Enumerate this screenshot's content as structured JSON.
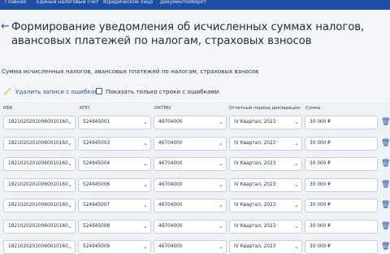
{
  "topnav": {
    "items": [
      "Главная",
      "Единый налоговый счет",
      "Юридическое лицо",
      "Документооборот"
    ]
  },
  "page": {
    "back_icon": "arrow-left-icon",
    "title": "Формирование уведомления об исчисленных суммах налогов, авансовых платежей по налогам, страховых взносов",
    "subtitle": "Сумма исчисленных налогов, авансовых платежей по налогам, страховых взносов"
  },
  "toolbar": {
    "delete_errors_label": "Удалить записи с ошибками",
    "show_errors_only_label": "Показать только строки с ошибками"
  },
  "table": {
    "headers": {
      "kbk": "КБК",
      "kpp": "КПП",
      "oktmo": "ОКТМО",
      "period": "Отчетный период декларации",
      "sum": "Сумма"
    },
    "rows": [
      {
        "kbk": "18210202010060010160",
        "kpp": "524945001",
        "oktmo": "46704000",
        "period": "IV Квартал, 2023",
        "sum": "30 000  ₽"
      },
      {
        "kbk": "18210202010060010160",
        "kpp": "524945003",
        "oktmo": "46704000",
        "period": "IV Квартал, 2023",
        "sum": "30 000  ₽"
      },
      {
        "kbk": "18210202010060010160",
        "kpp": "524945004",
        "oktmo": "46704000",
        "period": "IV Квартал, 2023",
        "sum": "30 000  ₽"
      },
      {
        "kbk": "18210202010060010160",
        "kpp": "524945006",
        "oktmo": "46704000",
        "period": "IV Квартал, 2023",
        "sum": "30 000  ₽"
      },
      {
        "kbk": "18210202010060010160",
        "kpp": "524945007",
        "oktmo": "46704000",
        "period": "IV Квартал, 2023",
        "sum": "30 000  ₽"
      },
      {
        "kbk": "18210202010060010160",
        "kpp": "524945008",
        "oktmo": "46704000",
        "period": "IV Квартал, 2023",
        "sum": "30 000  ₽"
      },
      {
        "kbk": "18210202010060010160",
        "kpp": "524945009",
        "oktmo": "46704000",
        "period": "IV Квартал, 2023",
        "sum": "30 000  ₽"
      }
    ]
  }
}
